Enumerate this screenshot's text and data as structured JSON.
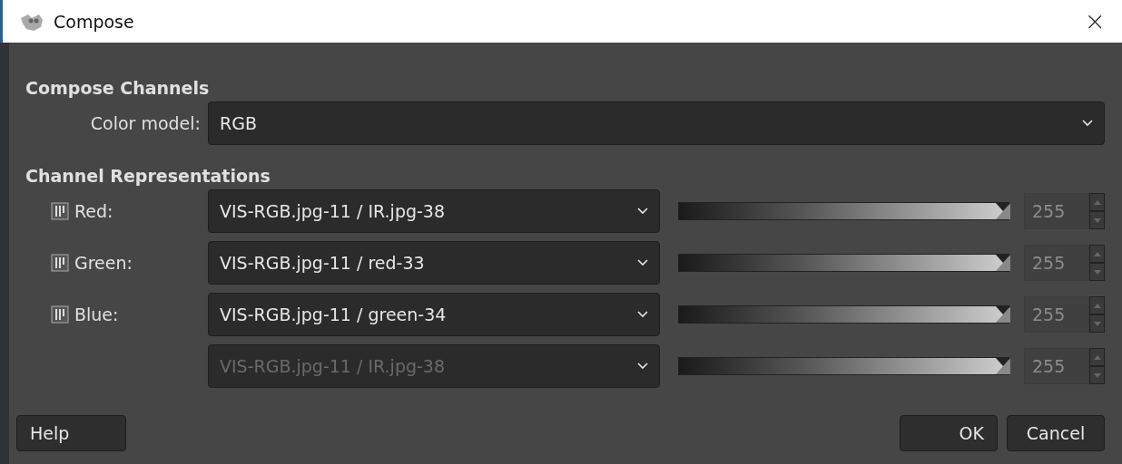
{
  "window": {
    "title": "Compose",
    "close": "×"
  },
  "compose_channels": {
    "heading": "Compose Channels",
    "color_model": {
      "label": "Color model:",
      "value": "RGB",
      "disabled": false
    }
  },
  "channel_representations": {
    "heading": "Channel Representations",
    "channels": [
      {
        "label": "Red:",
        "value": "VIS-RGB.jpg-11 / IR.jpg-38",
        "disabled": false,
        "level": 1,
        "spin": "255",
        "spin_disabled": true
      },
      {
        "label": "Green:",
        "value": "VIS-RGB.jpg-11 / red-33",
        "disabled": false,
        "level": 1,
        "spin": "255",
        "spin_disabled": true
      },
      {
        "label": "Blue:",
        "value": "VIS-RGB.jpg-11 / green-34",
        "disabled": false,
        "level": 1,
        "spin": "255",
        "spin_disabled": true
      },
      {
        "value": "VIS-RGB.jpg-11 / IR.jpg-38",
        "disabled": true,
        "level": 1,
        "spin": "255",
        "spin_disabled": true
      }
    ]
  },
  "buttons": {
    "left": [
      "Help"
    ],
    "right": [
      "OK",
      "Cancel"
    ]
  }
}
